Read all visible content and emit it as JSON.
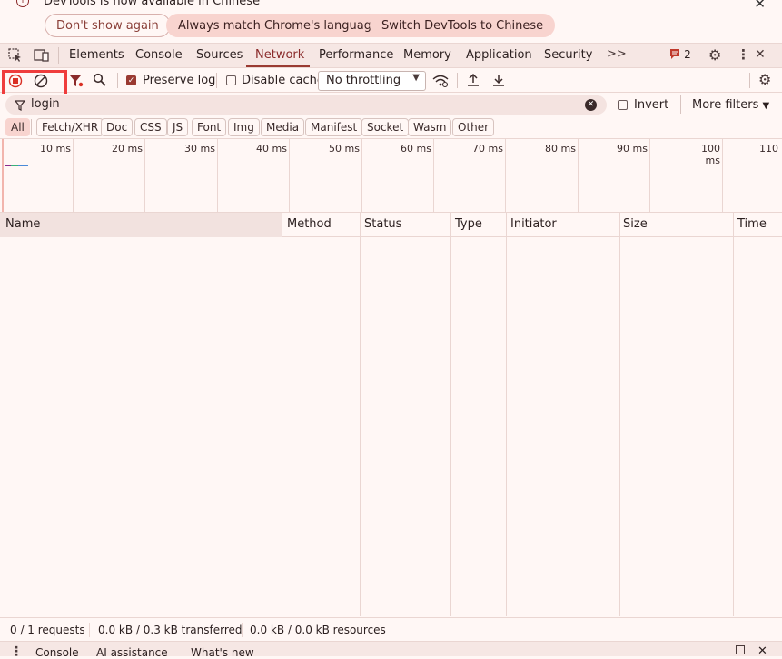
{
  "infobar": {
    "message": "DevTools is now available in Chinese",
    "dont_show": "Don't show again",
    "always_match": "Always match Chrome's language",
    "switch": "Switch DevTools to Chinese"
  },
  "tabs": {
    "items": [
      "Elements",
      "Console",
      "Sources",
      "Network",
      "Performance",
      "Memory",
      "Application",
      "Security"
    ],
    "active": "Network",
    "more": ">>",
    "issues_count": "2"
  },
  "toolbar": {
    "preserve_log": "Preserve log",
    "preserve_log_checked": true,
    "disable_cache": "Disable cache",
    "disable_cache_checked": false,
    "throttling": "No throttling"
  },
  "filter": {
    "value": "login",
    "invert": "Invert",
    "more_filters": "More filters"
  },
  "chips": [
    "All",
    "Fetch/XHR",
    "Doc",
    "CSS",
    "JS",
    "Font",
    "Img",
    "Media",
    "Manifest",
    "Socket",
    "Wasm",
    "Other"
  ],
  "overview": {
    "ticks": [
      "10 ms",
      "20 ms",
      "30 ms",
      "40 ms",
      "50 ms",
      "60 ms",
      "70 ms",
      "80 ms",
      "90 ms",
      "100 ms",
      "110"
    ]
  },
  "table": {
    "columns": [
      "Name",
      "Method",
      "Status",
      "Type",
      "Initiator",
      "Size",
      "Time"
    ]
  },
  "status": {
    "requests": "0 / 1 requests",
    "transferred": "0.0 kB / 0.3 kB transferred",
    "resources": "0.0 kB / 0.0 kB resources"
  },
  "drawer": {
    "console": "Console",
    "ai": "AI assistance",
    "whats_new": "What's new"
  }
}
